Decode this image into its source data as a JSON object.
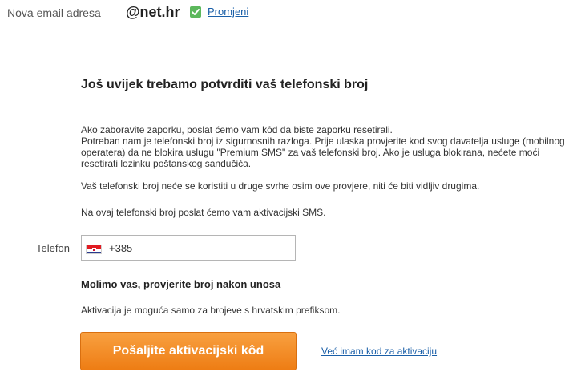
{
  "email_row": {
    "label": "Nova email adresa",
    "value": "@net.hr",
    "change_link": "Promjeni",
    "status_icon": "check-icon",
    "status_color": "#5cb85c"
  },
  "main": {
    "heading": "Još uvijek trebamo potvrditi vaš telefonski broj",
    "paragraph1": "Ako zaboravite zaporku, poslat ćemo vam kôd da biste zaporku resetirali.\nPotreban nam je telefonski broj iz sigurnosnih razloga. Prije ulaska provjerite kod svog davatelja usluge (mobilnog operatera) da ne blokira uslugu \"Premium SMS\" za vaš telefonski broj. Ako je usluga blokirana, nećete moći resetirati lozinku poštanskog sandučića.",
    "paragraph2": "Vaš telefonski broj neće se koristiti u druge svrhe osim ove provjere, niti će biti vidljiv drugima.",
    "paragraph3": "Na ovaj telefonski broj poslat ćemo vam aktivacijski SMS."
  },
  "phone": {
    "label": "Telefon",
    "value": "+385",
    "flag_icon": "croatia-flag-icon"
  },
  "verify_note": "Molimo vas, provjerite broj nakon unosa",
  "prefix_note": "Aktivacija je moguća samo za brojeve s hrvatskim prefiksom.",
  "actions": {
    "send_button": "Pošaljite aktivacijski kôd",
    "have_code_link": "Već imam kod za aktivaciju",
    "button_color": "#ee7d14",
    "link_color": "#1a5fa8"
  }
}
